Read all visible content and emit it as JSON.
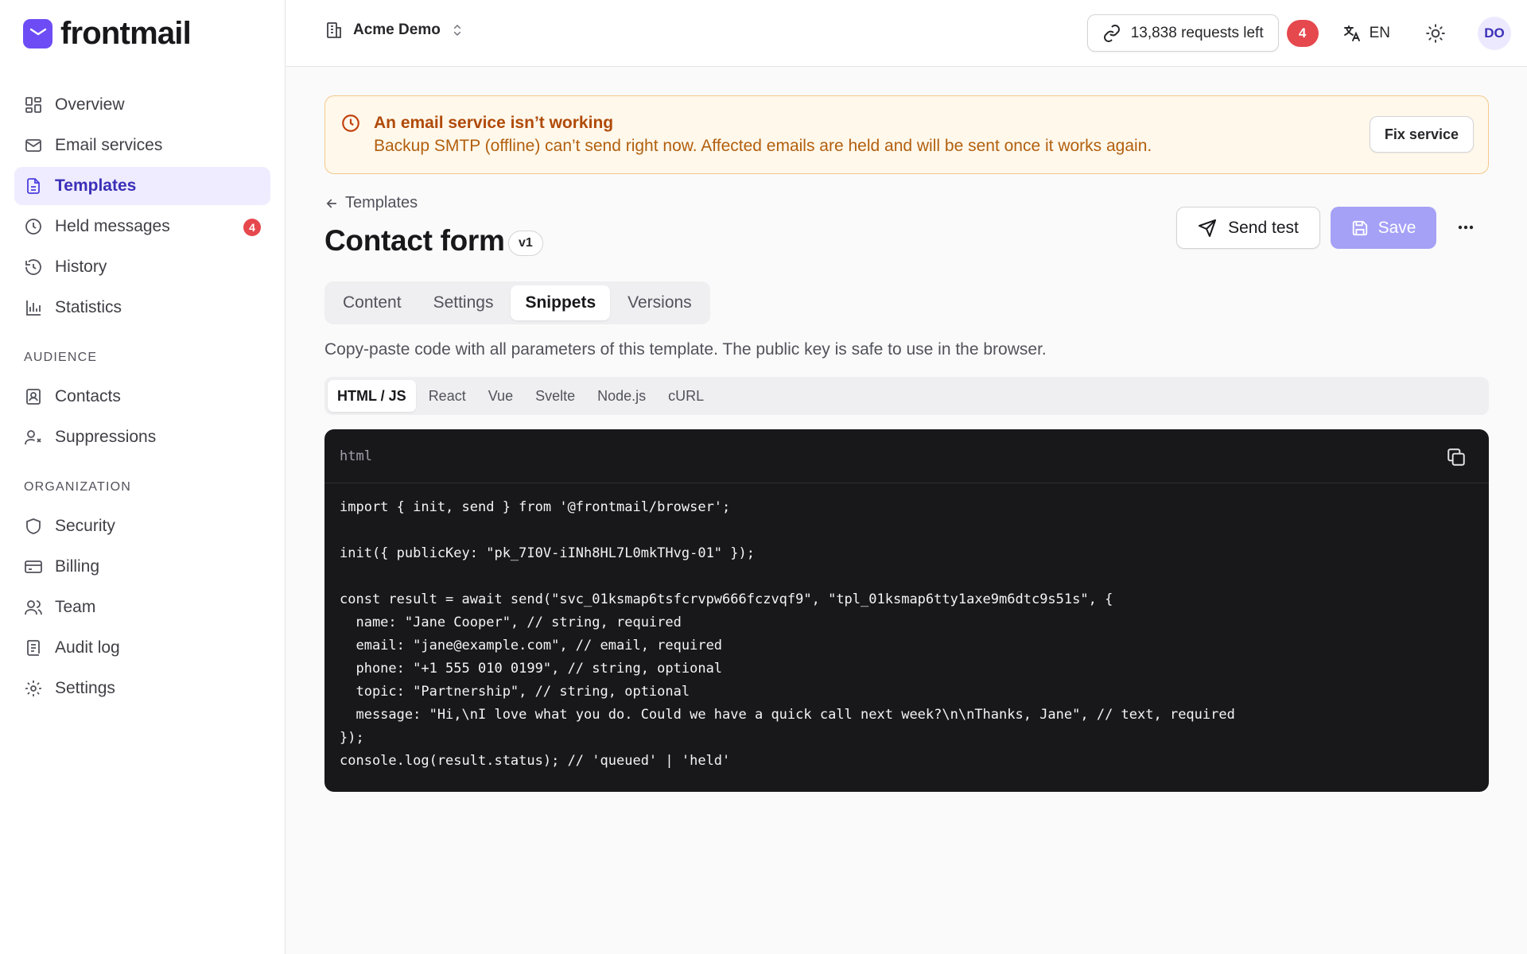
{
  "brand": {
    "name": "frontmail",
    "accent": "#6d4cf5"
  },
  "sidebar": {
    "main": [
      {
        "label": "Overview",
        "icon": "dashboard-icon"
      },
      {
        "label": "Email services",
        "icon": "mail-icon"
      },
      {
        "label": "Templates",
        "icon": "file-text-icon",
        "active": true
      },
      {
        "label": "Held messages",
        "icon": "clock-icon",
        "badge": "4"
      },
      {
        "label": "History",
        "icon": "history-icon"
      },
      {
        "label": "Statistics",
        "icon": "bar-chart-icon"
      }
    ],
    "audience_title": "AUDIENCE",
    "audience": [
      {
        "label": "Contacts",
        "icon": "contact-card-icon"
      },
      {
        "label": "Suppressions",
        "icon": "user-x-icon"
      }
    ],
    "organization_title": "ORGANIZATION",
    "organization": [
      {
        "label": "Security",
        "icon": "shield-icon"
      },
      {
        "label": "Billing",
        "icon": "credit-card-icon"
      },
      {
        "label": "Team",
        "icon": "users-icon"
      },
      {
        "label": "Audit log",
        "icon": "audit-log-icon"
      },
      {
        "label": "Settings",
        "icon": "gear-icon"
      }
    ]
  },
  "header": {
    "org_name": "Acme Demo",
    "requests_left": "13,838 requests left",
    "notifications_badge": "4",
    "language": "EN",
    "avatar_initials": "DO"
  },
  "alert": {
    "title": "An email service isn’t working",
    "body": "Backup SMTP (offline) can’t send right now. Affected emails are held and will be sent once it works again.",
    "action": "Fix service"
  },
  "page": {
    "breadcrumb": "Templates",
    "title": "Contact form",
    "version": "v1",
    "send_test_label": "Send test",
    "save_label": "Save"
  },
  "tabs": [
    {
      "label": "Content"
    },
    {
      "label": "Settings"
    },
    {
      "label": "Snippets",
      "active": true
    },
    {
      "label": "Versions"
    }
  ],
  "description": "Copy-paste code with all parameters of this template. The public key is safe to use in the browser.",
  "snippet_tabs": [
    {
      "label": "HTML / JS",
      "active": true
    },
    {
      "label": "React"
    },
    {
      "label": "Vue"
    },
    {
      "label": "Svelte"
    },
    {
      "label": "Node.js"
    },
    {
      "label": "cURL"
    }
  ],
  "code": {
    "language": "html",
    "lines": [
      "import { init, send } from '@frontmail/browser';",
      "",
      "init({ publicKey: \"pk_7I0V-iINh8HL7L0mkTHvg-01\" });",
      "",
      "const result = await send(\"svc_01ksmap6tsfcrvpw666fczvqf9\", \"tpl_01ksmap6tty1axe9m6dtc9s51s\", {",
      "  name: \"Jane Cooper\", // string, required",
      "  email: \"jane@example.com\", // email, required",
      "  phone: \"+1 555 010 0199\", // string, optional",
      "  topic: \"Partnership\", // string, optional",
      "  message: \"Hi,\\nI love what you do. Could we have a quick call next week?\\n\\nThanks, Jane\", // text, required",
      "});",
      "console.log(result.status); // 'queued' | 'held'"
    ]
  }
}
